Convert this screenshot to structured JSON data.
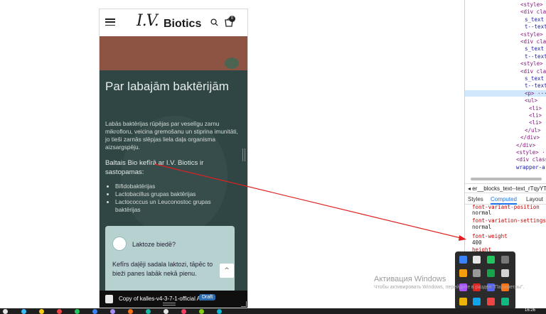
{
  "mobile": {
    "logo_mark": "I.V.",
    "logo_text": "Biotics",
    "cart_count": "0",
    "title": "Par labajām baktērijām",
    "paragraph": "Labās baktērijas rūpējas par veselīgu zarnu mikrofloru, veicina gremošanu un stiprina imunitāti, jo tieši zarnās slēpjas liela daļa organisma aizsargspēju.",
    "subheading": "Baltais Bio kefīrā ar I.V. Biotics ir sastopamas:",
    "list": [
      "Bifidobaktērijas",
      "Lactobacillus grupas baktērijas",
      "Lactococcus un Leuconostoc grupas baktērijas"
    ],
    "card": {
      "title": "Laktoze biedē?",
      "text": "Kefīrs daļēji sadala laktozi, tāpēc to bieži panes labāk nekā pienu."
    },
    "scroll_top_label": "^",
    "footer": {
      "text": "Copy of kalles-v4-3-7-1-official AR",
      "badge": "Draft"
    }
  },
  "devtools": {
    "dom_lines": [
      {
        "text": "<style>",
        "indent": 1
      },
      {
        "text": "<div clas",
        "indent": 1
      },
      {
        "text": "s_text la",
        "indent": 2
      },
      {
        "text": "t--text_q",
        "indent": 2
      },
      {
        "text": "<style> ",
        "indent": 1
      },
      {
        "text": "<div clas",
        "indent": 1
      },
      {
        "text": "s_text la",
        "indent": 2
      },
      {
        "text": "t--text_w",
        "indent": 2
      },
      {
        "text": "<style> ",
        "indent": 1
      },
      {
        "text": "<div clas",
        "indent": 1
      },
      {
        "text": "s_text la",
        "indent": 2
      },
      {
        "text": "t--text_r",
        "indent": 2
      },
      {
        "text": "<p> ··· ",
        "indent": 2
      },
      {
        "text": "<ul>",
        "indent": 2
      },
      {
        "text": "<li>",
        "indent": 3
      },
      {
        "text": "<li>",
        "indent": 3
      },
      {
        "text": "<li>",
        "indent": 3
      },
      {
        "text": "</ul>",
        "indent": 2
      },
      {
        "text": "</div>",
        "indent": 1
      },
      {
        "text": "</div>",
        "indent": 0
      },
      {
        "text": "<style> ··· ",
        "indent": 0
      },
      {
        "text": "<div class",
        "indent": 0
      },
      {
        "text": "wrapper-are",
        "indent": 0
      }
    ],
    "breadcrumb": "er__blocks_text--text_rTqyYT",
    "tabs": [
      "Styles",
      "Computed",
      "Layout"
    ],
    "active_tab": "Computed",
    "props": [
      {
        "name": "font-variant-position",
        "value": "normal"
      },
      {
        "name": "font-variation-settings",
        "value": "normal"
      },
      {
        "name": "font-weight",
        "value": "400"
      },
      {
        "name": "height",
        "value": ""
      }
    ]
  },
  "watermark": {
    "title": "Активация Windows",
    "subtitle": "Чтобы активировать Windows, перейдите в раздел \"Параметры\"."
  },
  "taskbar": {
    "clock": "16:26"
  },
  "colors": {
    "page_accent": "#2f4644",
    "annotation": "#e02020",
    "link_blue": "#1a73e8"
  }
}
